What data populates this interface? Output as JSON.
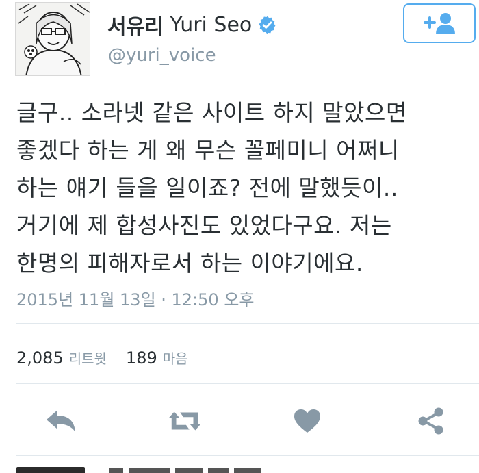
{
  "user": {
    "display_name_ko": "서유리",
    "display_name_en": "Yuri Seo",
    "handle": "@yuri_voice",
    "verified": true
  },
  "tweet": {
    "text": "글구.. 소라넷 같은 사이트 하지 말았으면\n좋겠다 하는 게 왜 무슨 꼴페미니 어쩌니\n하는 얘기 들을 일이죠? 전에 말했듯이..\n거기에 제 합성사진도 있었다구요. 저는\n한명의 피해자로서 하는 이야기에요.",
    "timestamp": "2015년 11월 13일 · 12:50 오후"
  },
  "stats": {
    "retweets_count": "2,085",
    "retweets_label": "리트윗",
    "likes_count": "189",
    "likes_label": "마음"
  },
  "icons": {
    "follow": "add-user-icon",
    "verified": "verified-badge-icon",
    "reply": "reply-icon",
    "retweet": "retweet-icon",
    "like": "heart-icon",
    "share": "share-icon"
  },
  "colors": {
    "accent": "#55acee",
    "text": "#292f33",
    "muted": "#8899a6",
    "icon": "#8899a6",
    "divider": "#e1e8ed"
  }
}
